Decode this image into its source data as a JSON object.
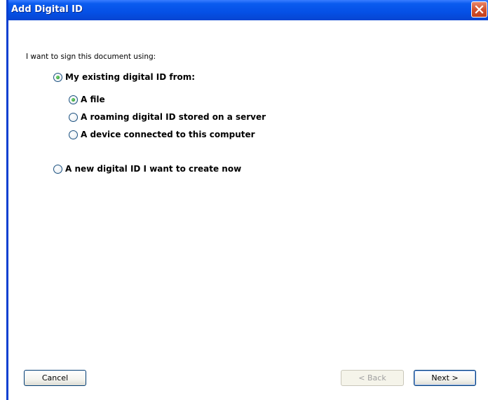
{
  "window": {
    "title": "Add Digital ID",
    "close_icon": "close-icon"
  },
  "prompt": "I want to sign this document using:",
  "options": {
    "existing": {
      "label": "My existing digital ID from:",
      "checked": true
    },
    "file": {
      "label": "A file",
      "checked": true
    },
    "roaming": {
      "label": "A roaming digital ID stored on a server",
      "checked": false
    },
    "device": {
      "label": "A device connected to this computer",
      "checked": false
    },
    "new_id": {
      "label": "A new digital ID I want to create now",
      "checked": false
    }
  },
  "buttons": {
    "cancel": "Cancel",
    "back": "< Back",
    "next": "Next >"
  },
  "colors": {
    "titlebar": "#0550e6",
    "close_button": "#d3522e",
    "radio_dot": "#2f9a2f"
  }
}
